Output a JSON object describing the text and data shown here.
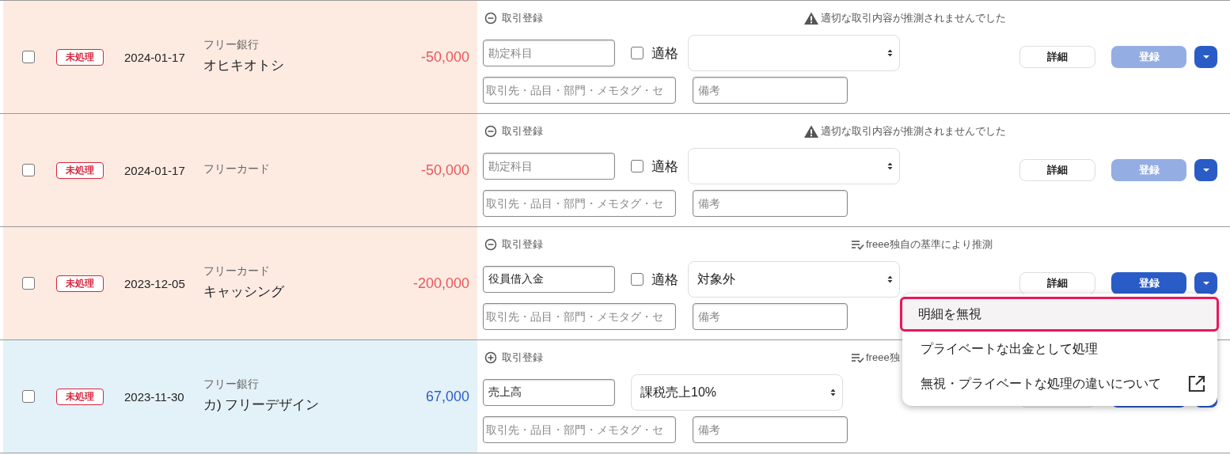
{
  "rows": [
    {
      "checked": false,
      "status": "未処理",
      "date": "2024-01-17",
      "source": "フリー銀行",
      "description": "オヒキオトシ",
      "amount": "-50,000",
      "kind": "expense",
      "register": {
        "label": "取引登録",
        "expanded": true
      },
      "hint": {
        "kind": "warning",
        "text": "適切な取引内容が推測されませんでした"
      },
      "account_field": {
        "placeholder": "勘定科目"
      },
      "qualified": {
        "label": "適格",
        "checked": false
      },
      "tax_select": {},
      "partner_field": {
        "placeholder": "取引先・品目・部門・メモタグ・セ"
      },
      "memo_field": {
        "placeholder": "備考"
      },
      "detail_button": {
        "label": "詳細"
      },
      "register_button": {
        "label": "登録",
        "disabled": true
      }
    },
    {
      "checked": false,
      "status": "未処理",
      "date": "2024-01-17",
      "source": "フリーカード",
      "amount": "-50,000",
      "kind": "expense",
      "register": {
        "label": "取引登録",
        "expanded": true
      },
      "hint": {
        "kind": "warning",
        "text": "適切な取引内容が推測されませんでした"
      },
      "account_field": {
        "placeholder": "勘定科目"
      },
      "qualified": {
        "label": "適格",
        "checked": false
      },
      "tax_select": {},
      "partner_field": {
        "placeholder": "取引先・品目・部門・メモタグ・セ"
      },
      "memo_field": {
        "placeholder": "備考"
      },
      "detail_button": {
        "label": "詳細"
      },
      "register_button": {
        "label": "登録",
        "disabled": true
      }
    },
    {
      "checked": false,
      "status": "未処理",
      "date": "2023-12-05",
      "source": "フリーカード",
      "description": "キャッシング",
      "amount": "-200,000",
      "kind": "expense",
      "register": {
        "label": "取引登録",
        "expanded": true
      },
      "hint": {
        "kind": "estimate",
        "text": "freee独自の基準により推測"
      },
      "account_field": {
        "value": "役員借入金"
      },
      "qualified": {
        "label": "適格",
        "checked": false
      },
      "tax_select": {
        "value": "対象外"
      },
      "partner_field": {
        "placeholder": "取引先・品目・部門・メモタグ・セ"
      },
      "memo_field": {
        "placeholder": "備考"
      },
      "detail_button": {
        "label": "詳細"
      },
      "register_button": {
        "label": "登録",
        "disabled": false
      }
    },
    {
      "checked": false,
      "status": "未処理",
      "date": "2023-11-30",
      "source": "フリー銀行",
      "description": "カ) フリーデザイン",
      "amount": "67,000",
      "kind": "income",
      "register": {
        "label": "取引登録",
        "expanded": false
      },
      "hint": {
        "kind": "estimate",
        "text": "freee独"
      },
      "account_field": {
        "value": "売上高"
      },
      "tax_select": {
        "value": "課税売上10%"
      },
      "partner_field": {
        "placeholder": "取引先・品目・部門・メモタグ・セ"
      },
      "memo_field": {
        "placeholder": "備考"
      },
      "detail_button": {},
      "register_button": {
        "disabled": false
      }
    }
  ],
  "menu": {
    "items": [
      {
        "label": "明細を無視",
        "selected": true,
        "external": false
      },
      {
        "label": "プライベートな出金として処理",
        "selected": false,
        "external": false
      },
      {
        "label": "無視・プライベートな処理の違いについて",
        "selected": false,
        "external": true
      }
    ]
  }
}
